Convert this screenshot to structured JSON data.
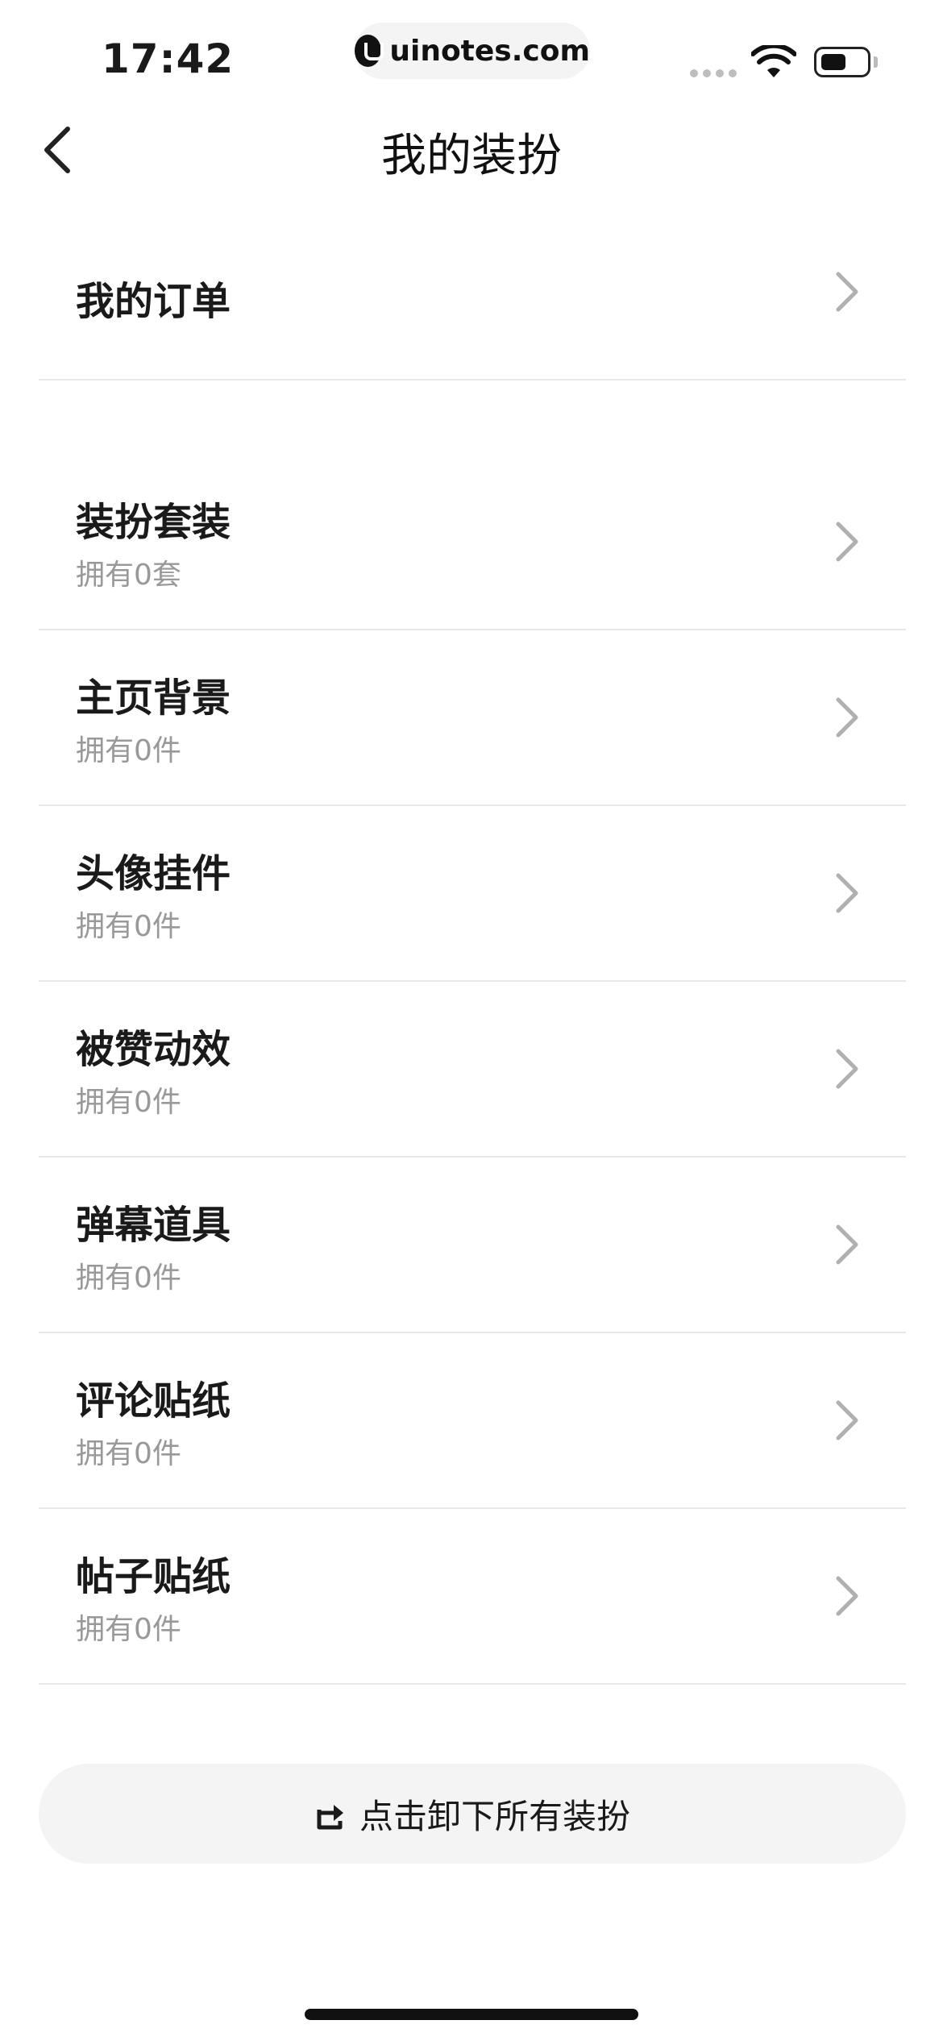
{
  "status_bar": {
    "time": "17:42",
    "url": "uinotes.com"
  },
  "nav": {
    "title": "我的装扮",
    "back_icon": "chevron-left-icon"
  },
  "orders": {
    "label": "我的订单"
  },
  "items": [
    {
      "label": "装扮套装",
      "sub": "拥有0套"
    },
    {
      "label": "主页背景",
      "sub": "拥有0件"
    },
    {
      "label": "头像挂件",
      "sub": "拥有0件"
    },
    {
      "label": "被赞动效",
      "sub": "拥有0件"
    },
    {
      "label": "弹幕道具",
      "sub": "拥有0件"
    },
    {
      "label": "评论贴纸",
      "sub": "拥有0件"
    },
    {
      "label": "帖子贴纸",
      "sub": "拥有0件"
    }
  ],
  "unload_button": {
    "label": "点击卸下所有装扮",
    "icon": "export-icon"
  },
  "colors": {
    "title_text": "#1a1a1a",
    "sub_text": "#999999",
    "divider": "#e8e8e8",
    "button_bg": "#f4f4f4",
    "chevron": "#b0b0b0"
  }
}
